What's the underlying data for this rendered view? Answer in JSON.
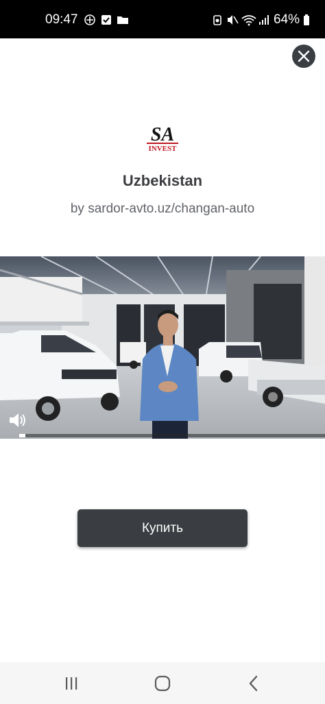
{
  "status_bar": {
    "time": "09:47",
    "battery": "64%"
  },
  "header": {
    "title": "Uzbekistan",
    "subtitle": "by sardor-avto.uz/changan-auto"
  },
  "logo": {
    "text_main": "SA",
    "text_sub": "INVEST"
  },
  "video": {
    "progress": 0.02
  },
  "actions": {
    "buy_label": "Купить"
  },
  "colors": {
    "button_dark": "#3a3d41",
    "logo_red": "#c0171d"
  }
}
